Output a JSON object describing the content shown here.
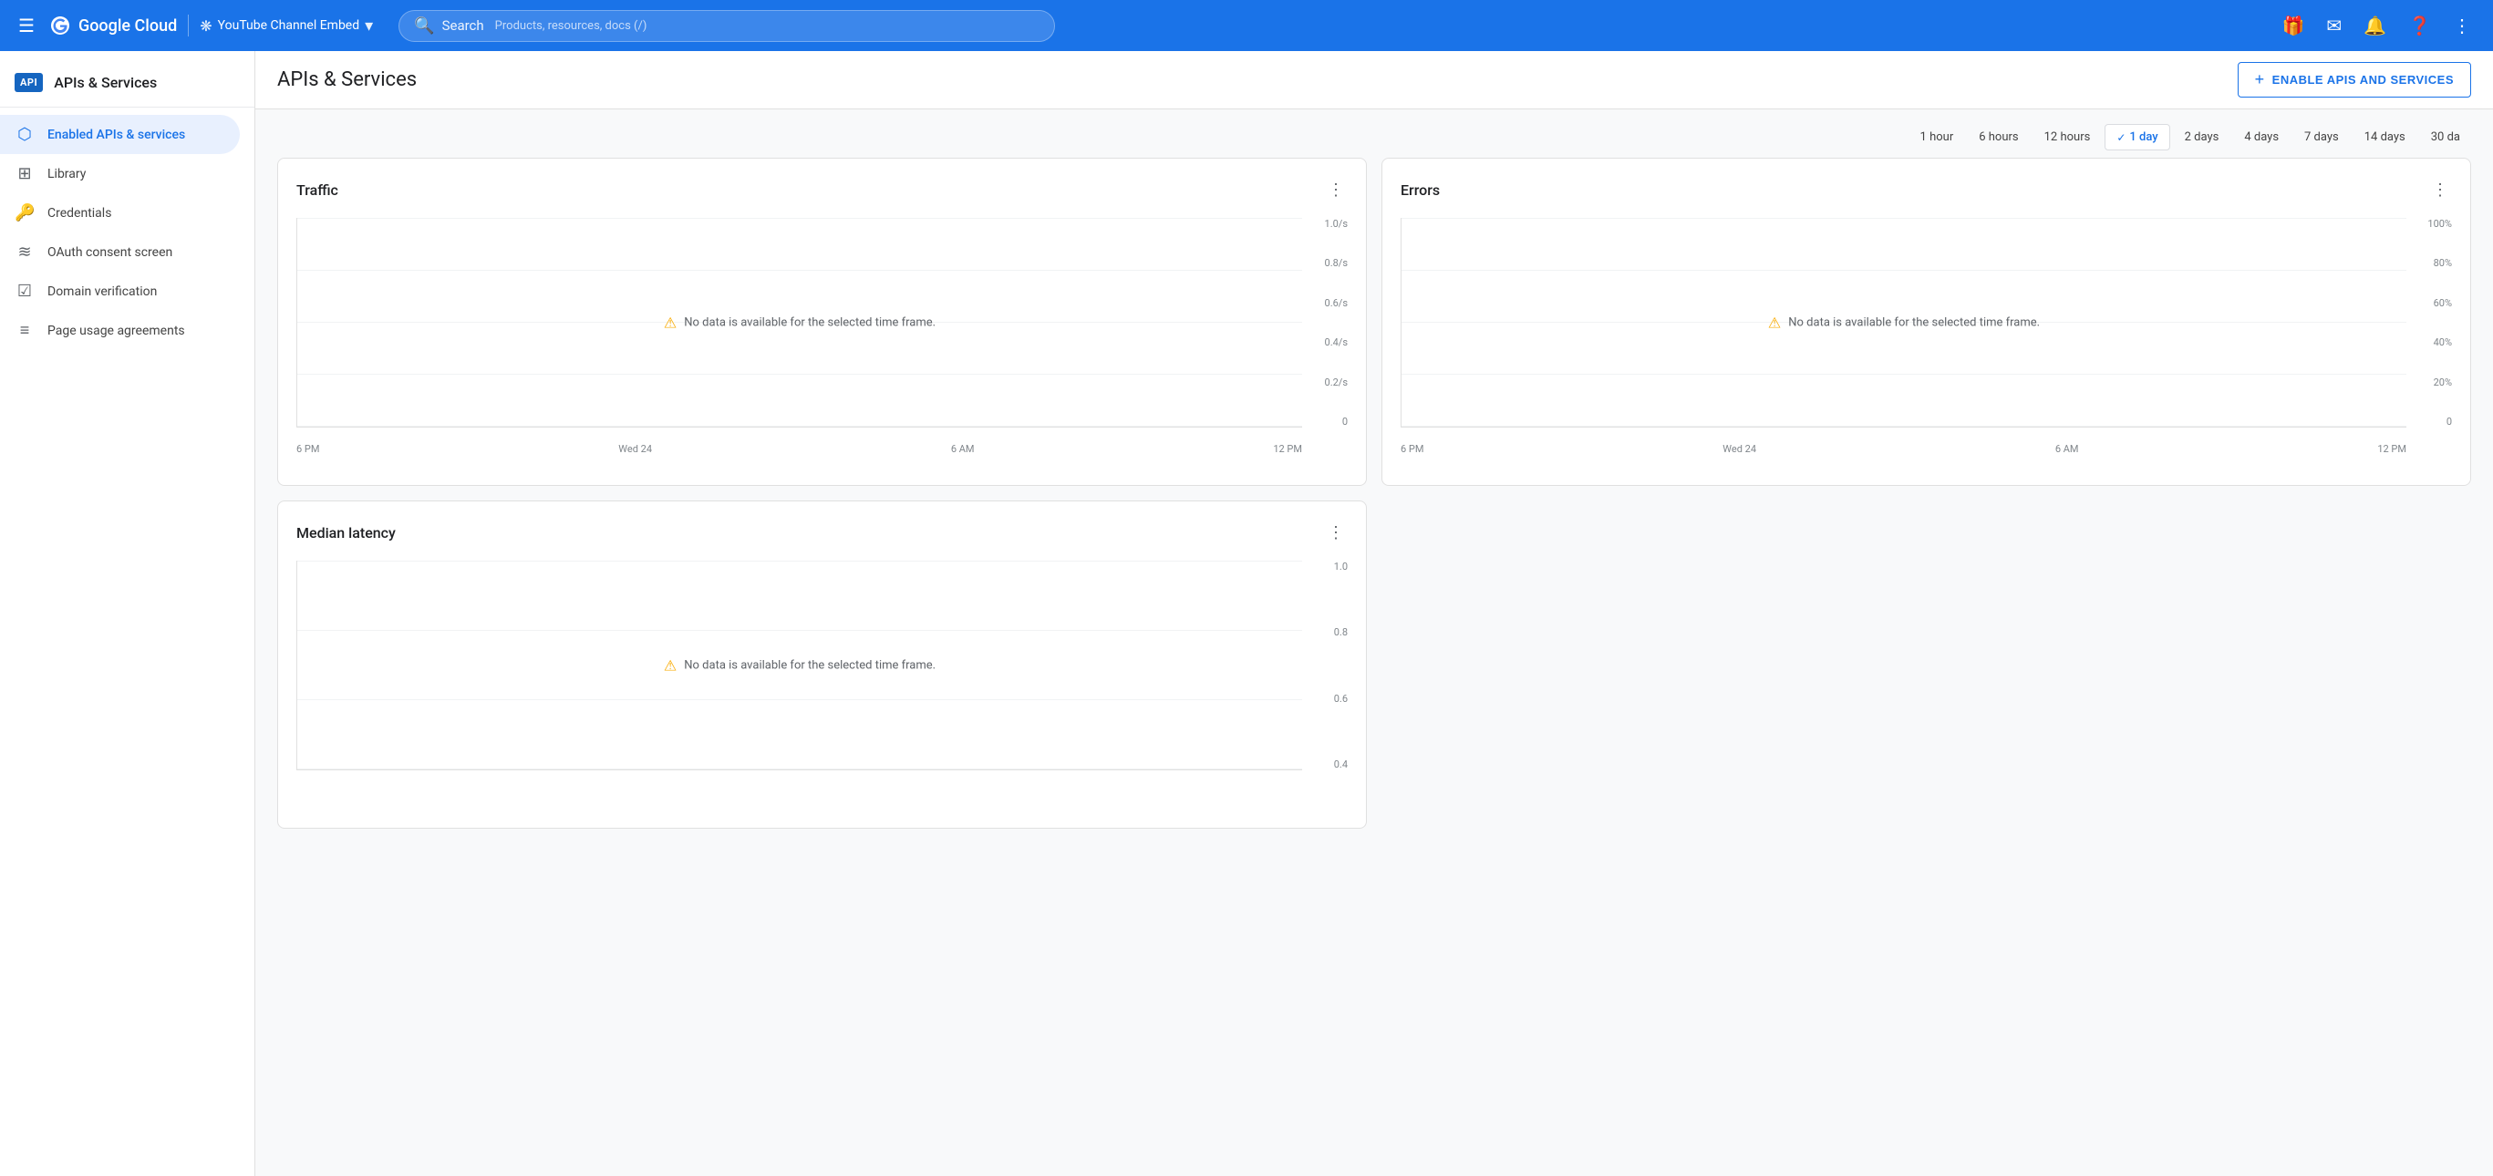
{
  "topnav": {
    "menu_icon": "☰",
    "logo_text": "Google Cloud",
    "project_name": "YouTube Channel Embed",
    "search_placeholder": "Search",
    "search_hint": "Products, resources, docs (/)",
    "icons": {
      "gift": "🎁",
      "email": "✉",
      "bell": "🔔",
      "help": "?"
    }
  },
  "sidebar": {
    "badge": "API",
    "title": "APIs & Services",
    "items": [
      {
        "id": "enabled-apis",
        "label": "Enabled APIs & services",
        "icon": "⬡",
        "active": true
      },
      {
        "id": "library",
        "label": "Library",
        "icon": "⊞",
        "active": false
      },
      {
        "id": "credentials",
        "label": "Credentials",
        "icon": "🔑",
        "active": false
      },
      {
        "id": "oauth",
        "label": "OAuth consent screen",
        "icon": "≋",
        "active": false
      },
      {
        "id": "domain",
        "label": "Domain verification",
        "icon": "☑",
        "active": false
      },
      {
        "id": "page-usage",
        "label": "Page usage agreements",
        "icon": "≡",
        "active": false
      }
    ]
  },
  "page": {
    "title": "APIs & Services",
    "enable_btn": "ENABLE APIS AND SERVICES"
  },
  "time_range": {
    "options": [
      "1 hour",
      "6 hours",
      "12 hours",
      "1 day",
      "2 days",
      "4 days",
      "7 days",
      "14 days",
      "30 da"
    ],
    "active": "1 day"
  },
  "charts": {
    "traffic": {
      "title": "Traffic",
      "no_data_msg": "No data is available for the selected time frame.",
      "y_labels": [
        "1.0/s",
        "0.8/s",
        "0.6/s",
        "0.4/s",
        "0.2/s",
        "0"
      ],
      "x_labels": [
        "6 PM",
        "Wed 24",
        "6 AM",
        "12 PM"
      ]
    },
    "errors": {
      "title": "Errors",
      "no_data_msg": "No data is available for the selected time frame.",
      "y_labels": [
        "100%",
        "80%",
        "60%",
        "40%",
        "20%",
        "0"
      ],
      "x_labels": [
        "6 PM",
        "Wed 24",
        "6 AM",
        "12 PM"
      ]
    },
    "median_latency": {
      "title": "Median latency",
      "no_data_msg": "No data is available for the selected time frame.",
      "y_labels": [
        "1.0",
        "0.8",
        "0.6",
        "0.4"
      ],
      "x_labels": []
    }
  }
}
